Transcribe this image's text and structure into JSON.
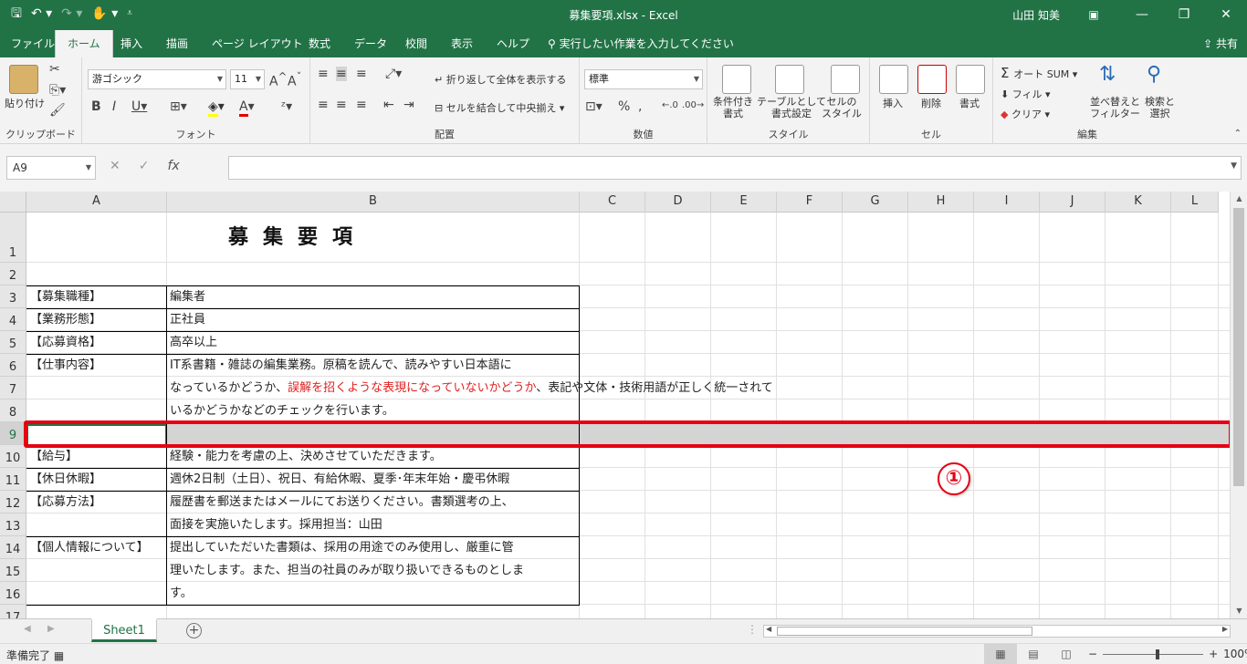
{
  "window": {
    "title": "募集要項.xlsx  -  Excel",
    "user": "山田 知美"
  },
  "tabs": [
    "ファイル",
    "ホーム",
    "挿入",
    "描画",
    "ページ レイアウト",
    "数式",
    "データ",
    "校閲",
    "表示",
    "ヘルプ"
  ],
  "tellme": "実行したい作業を入力してください",
  "share": "共有",
  "ribbon": {
    "clipboard": {
      "paste": "貼り付け",
      "label": "クリップボード"
    },
    "font": {
      "name": "游ゴシック",
      "size": "11",
      "label": "フォント"
    },
    "alignment": {
      "wrap": "折り返して全体を表示する",
      "merge": "セルを結合して中央揃え",
      "label": "配置"
    },
    "number": {
      "format": "標準",
      "label": "数値"
    },
    "styles": {
      "conditional": "条件付き\n書式",
      "table": "テーブルとして\n書式設定",
      "cellstyle": "セルの\nスタイル",
      "label": "スタイル"
    },
    "cells": {
      "insert": "挿入",
      "delete": "削除",
      "format": "書式",
      "label": "セル"
    },
    "editing": {
      "autosum": "オート SUM",
      "fill": "フィル",
      "clear": "クリア",
      "sort": "並べ替えと\nフィルター",
      "find": "検索と\n選択",
      "label": "編集"
    }
  },
  "formula": {
    "namebox": "A9",
    "fx": "fx"
  },
  "columns": [
    "A",
    "B",
    "C",
    "D",
    "E",
    "F",
    "G",
    "H",
    "I",
    "J",
    "K",
    "L"
  ],
  "rows": [
    "1",
    "2",
    "3",
    "4",
    "5",
    "6",
    "7",
    "8",
    "9",
    "10",
    "11",
    "12",
    "13",
    "14",
    "15",
    "16",
    "17"
  ],
  "sheet": {
    "title": "募集要項",
    "r3a": "【募集職種】",
    "r3b": "編集者",
    "r4a": "【業務形態】",
    "r4b": "正社員",
    "r5a": "【応募資格】",
    "r5b": "高卒以上",
    "r6a": "【仕事内容】",
    "r6b": "IT系書籍・雑誌の編集業務。原稿を読んで、読みやすい日本語に",
    "r7b_pre": "なっているかどうか、",
    "r7b_red": "誤解を招くような表現になっていないかどうか",
    "r7b_post": "、表記や文体・技術用語が正しく統一されて",
    "r8b": "いるかどうかなどのチェックを行います。",
    "r10a": "【給与】",
    "r10b": "経験・能力を考慮の上、決めさせていただきます。",
    "r11a": "【休日休暇】",
    "r11b": "週休2日制（土日）、祝日、有給休暇、夏季･年末年始・慶弔休暇",
    "r12a": "【応募方法】",
    "r12b": "履歴書を郵送またはメールにてお送りください。書類選考の上、",
    "r13b": "面接を実施いたします。採用担当：山田",
    "r14a": "【個人情報について】",
    "r14b": "提出していただいた書類は、採用の用途でのみ使用し、厳重に管",
    "r15b": "理いたします。また、担当の社員のみが取り扱いできるものとしま",
    "r16b": "す。"
  },
  "annotation": "①",
  "sheettab": "Sheet1",
  "status": {
    "ready": "準備完了",
    "zoom": "100%"
  }
}
